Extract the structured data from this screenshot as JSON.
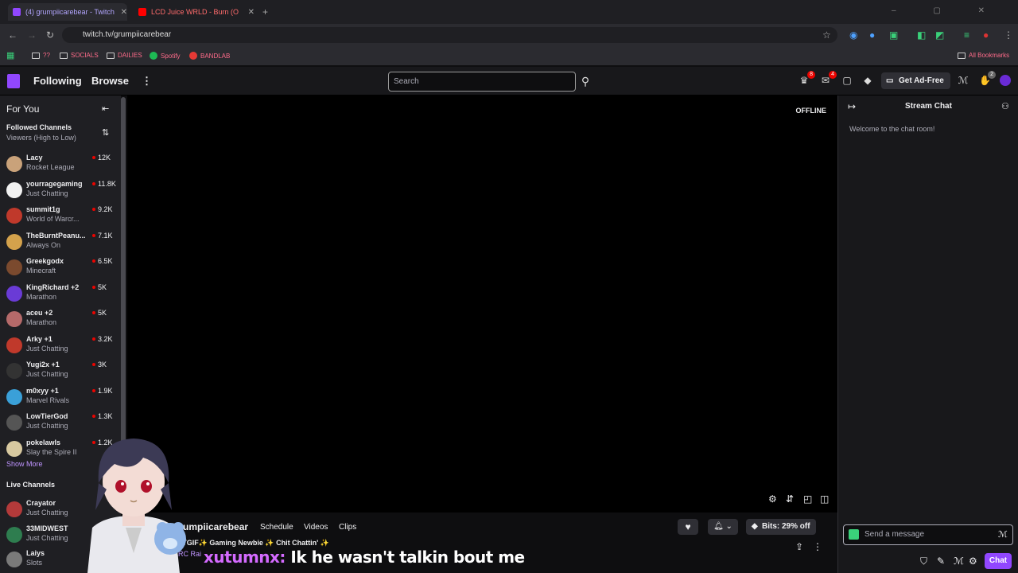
{
  "browser": {
    "tabs": [
      {
        "label": "(4) grumpiicarebear - Twitch"
      },
      {
        "label": "LCD Juice WRLD - Burn (O"
      }
    ],
    "url": "twitch.tv/grumpiicarebear",
    "bookmarks": [
      "??",
      "SOCIALS",
      "DAILIES",
      "Spotify",
      "BANDLAB"
    ],
    "all_bookmarks": "All Bookmarks"
  },
  "nav": {
    "following": "Following",
    "browse": "Browse",
    "search_placeholder": "Search",
    "get_ad_free": "Get Ad-Free",
    "badge_1": "8",
    "badge_2": "4",
    "badge_3": "2"
  },
  "sidebar": {
    "for_you": "For You",
    "followed_title": "Followed Channels",
    "sort": "Viewers (High to Low)",
    "followed": [
      {
        "name": "Lacy",
        "game": "Rocket League",
        "viewers": "12K",
        "color": "#c9a27a"
      },
      {
        "name": "yourragegaming",
        "game": "Just Chatting",
        "viewers": "11.8K",
        "color": "#f2f2f2"
      },
      {
        "name": "summit1g",
        "game": "World of Warcr...",
        "viewers": "9.2K",
        "color": "#c0392b"
      },
      {
        "name": "TheBurntPeanu...",
        "game": "Always On",
        "viewers": "7.1K",
        "color": "#d4a24c"
      },
      {
        "name": "Greekgodx",
        "game": "Minecraft",
        "viewers": "6.5K",
        "color": "#7b4a2e"
      },
      {
        "name": "KingRichard +2",
        "game": "Marathon",
        "viewers": "5K",
        "color": "#6a3bd6"
      },
      {
        "name": "aceu +2",
        "game": "Marathon",
        "viewers": "5K",
        "color": "#b56a6a"
      },
      {
        "name": "Arky +1",
        "game": "Just Chatting",
        "viewers": "3.2K",
        "color": "#c0392b"
      },
      {
        "name": "Yugi2x +1",
        "game": "Just Chatting",
        "viewers": "3K",
        "color": "#333333"
      },
      {
        "name": "m0xyy +1",
        "game": "Marvel Rivals",
        "viewers": "1.9K",
        "color": "#3aa0d8"
      },
      {
        "name": "LowTierGod",
        "game": "Just Chatting",
        "viewers": "1.3K",
        "color": "#555555"
      },
      {
        "name": "pokelawls",
        "game": "Slay the Spire II",
        "viewers": "1.2K",
        "color": "#d8c9a0"
      }
    ],
    "show_more": "Show More",
    "live_title": "Live Channels",
    "live": [
      {
        "name": "Crayator",
        "game": "Just Chatting",
        "viewers": "",
        "color": "#b33a3a"
      },
      {
        "name": "33MIDWEST",
        "game": "Just Chatting",
        "viewers": "",
        "color": "#2e7d4f"
      },
      {
        "name": "Laiys",
        "game": "Slots",
        "viewers": "",
        "color": "#7a7a7a"
      }
    ]
  },
  "player": {
    "status": "OFFLINE"
  },
  "stream": {
    "name": "grumpiicarebear",
    "links": [
      "Schedule",
      "Videos",
      "Clips"
    ],
    "title": "✨TGIF✨ Gaming Newbie ✨ Chit Chattin' ✨",
    "category": "ARC Rai",
    "bits": "Bits: 29% off"
  },
  "overlay": {
    "user": "xutumnx:",
    "message": "Ik he wasn't talkin bout me"
  },
  "chat": {
    "title": "Stream Chat",
    "welcome": "Welcome to the chat room!",
    "placeholder": "Send a message",
    "send": "Chat"
  },
  "colors": {
    "accent": "#9147ff",
    "live": "#eb0400"
  }
}
